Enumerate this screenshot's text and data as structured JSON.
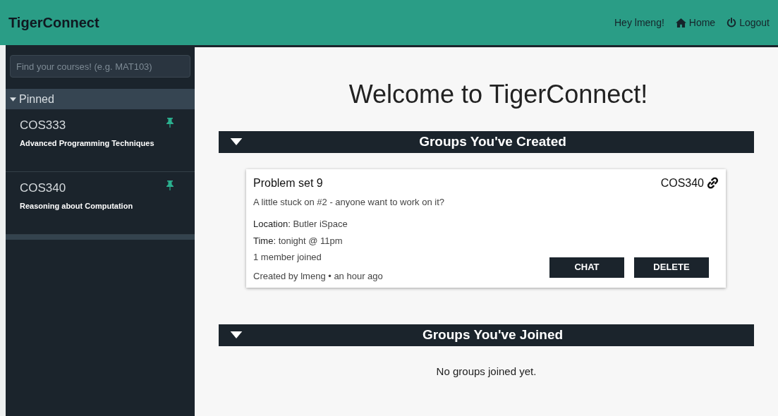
{
  "navbar": {
    "brand": "TigerConnect",
    "greeting": "Hey lmeng!",
    "links": [
      {
        "kind": "home",
        "label": "Home"
      },
      {
        "kind": "logout",
        "label": "Logout"
      }
    ]
  },
  "sidebar": {
    "search": {
      "placeholder": "Find your courses! (e.g. MAT103)"
    },
    "section": {
      "label": "Pinned",
      "expanded": true
    },
    "courses": [
      {
        "code": "COS333",
        "title": "Advanced Programming Techniques",
        "pinned": true
      },
      {
        "code": "COS340",
        "title": "Reasoning about Computation",
        "pinned": true
      }
    ]
  },
  "main": {
    "heading": "Welcome to TigerConnect!",
    "sections": [
      {
        "title": "Groups You've Created",
        "expanded": true,
        "groups": [
          {
            "title": "Problem set 9",
            "course": "COS340",
            "description": "A little stuck on #2 - anyone want to work on it?",
            "details": [
              {
                "label": "Location:",
                "value": "Butler iSpace"
              },
              {
                "label": "Time:",
                "value": "tonight @ 11pm"
              }
            ],
            "members": "1 member joined",
            "footer": "Created by lmeng • an hour ago",
            "buttons": [
              "CHAT",
              "DELETE"
            ]
          }
        ]
      },
      {
        "title": "Groups You've Joined",
        "expanded": true,
        "empty": "No groups joined yet."
      }
    ]
  }
}
